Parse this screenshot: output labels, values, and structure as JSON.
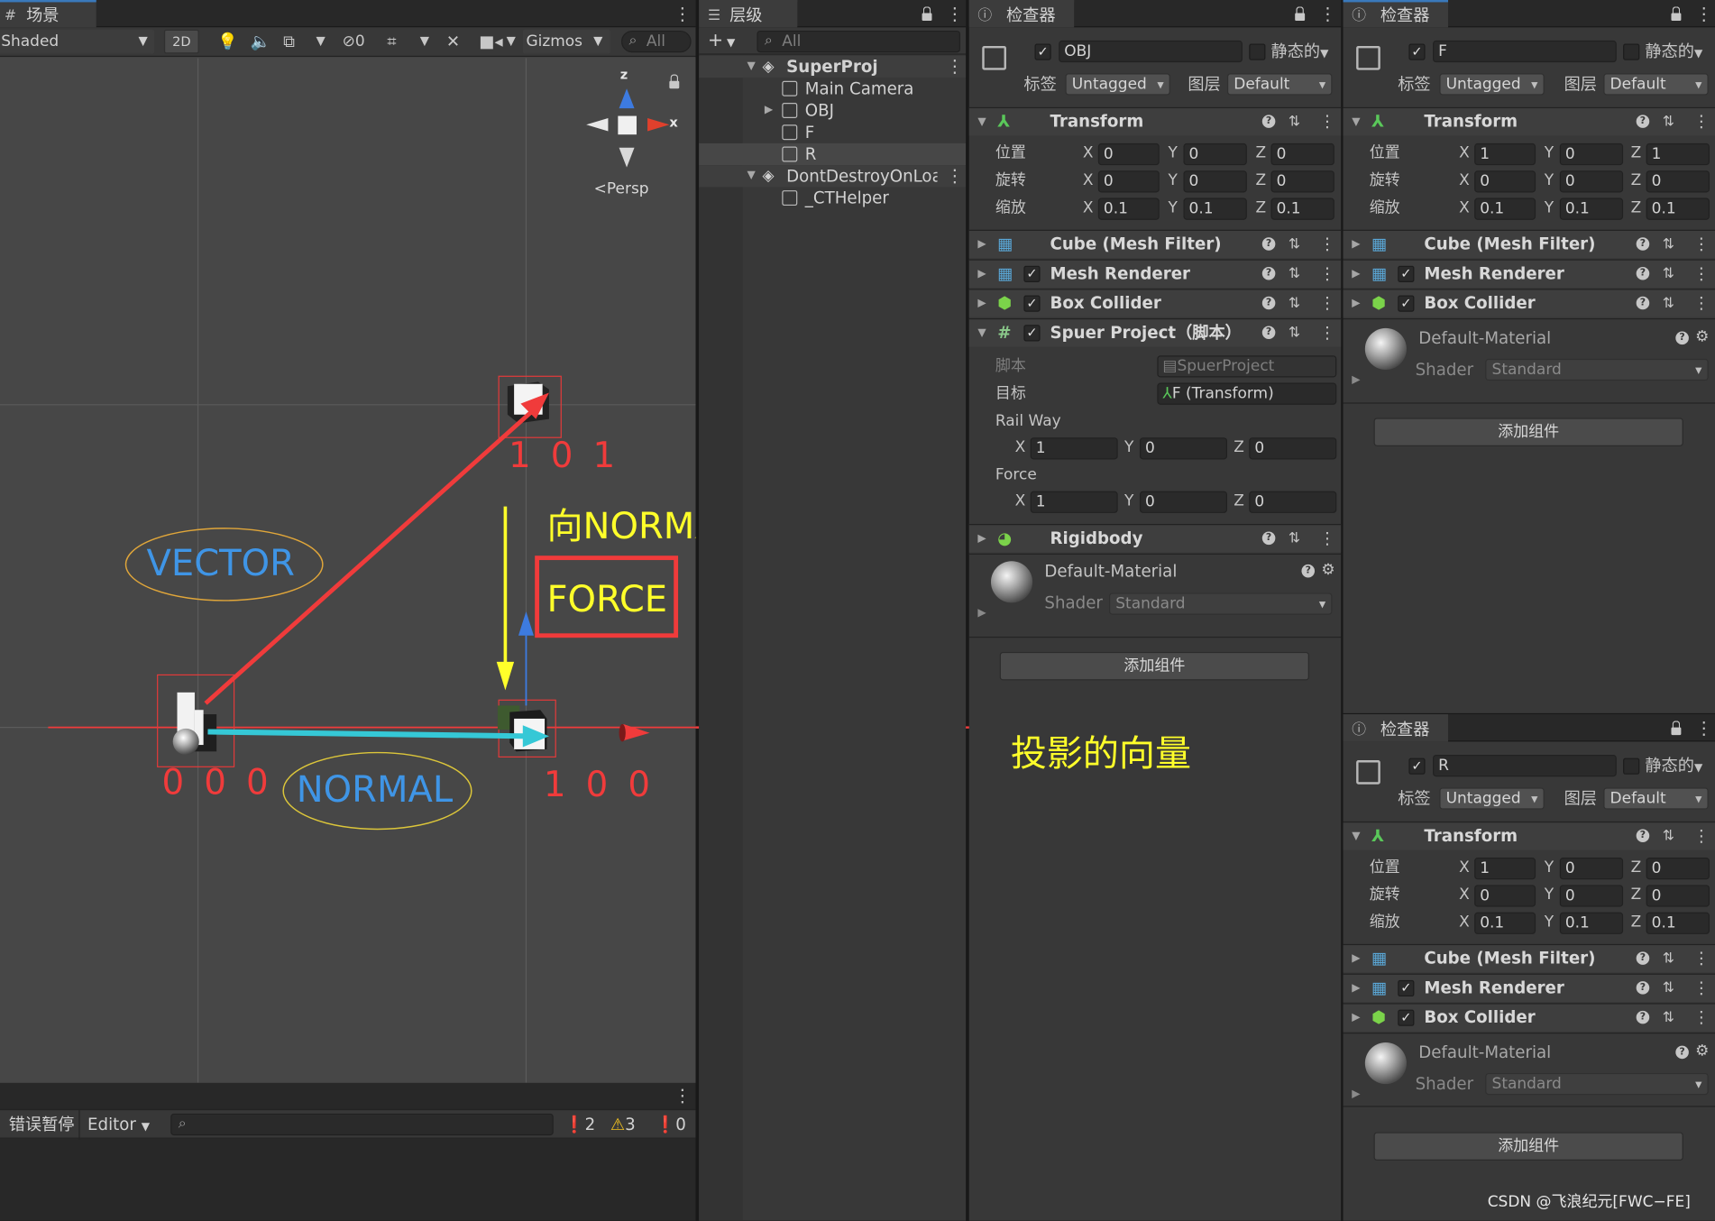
{
  "scene": {
    "tab": "场景",
    "shading": "Shaded",
    "mode_2d": "2D",
    "hidden_count": "0",
    "gizmos": "Gizmos",
    "search_placeholder": "All",
    "persp": "Persp",
    "gizmo_x": "x",
    "gizmo_z": "z"
  },
  "annotations": {
    "p1": "1 0 1",
    "p0": "0 0 0",
    "p2": "1 0 0",
    "vector": "VECTOR",
    "normal": "NORMAL",
    "force": "FORCE",
    "perp": "向NORMAL垂直投影",
    "projected": "投影的向量"
  },
  "console": {
    "error_pause": "错误暂停",
    "editor": "Editor",
    "count_info": "2",
    "count_warn": "3",
    "count_error": "0"
  },
  "hierarchy": {
    "tab": "层级",
    "search_placeholder": "All",
    "items": [
      {
        "label": "SuperProj"
      },
      {
        "label": "Main Camera"
      },
      {
        "label": "OBJ"
      },
      {
        "label": "F"
      },
      {
        "label": "R"
      },
      {
        "label": "DontDestroyOnLoad"
      },
      {
        "label": "_CTHelper"
      }
    ]
  },
  "insp1": {
    "tab": "检查器",
    "name": "OBJ",
    "static": "静态的",
    "tag_label": "标签",
    "tag": "Untagged",
    "layer_label": "图层",
    "layer": "Default",
    "transform": "Transform",
    "pos_label": "位置",
    "rot_label": "旋转",
    "scale_label": "缩放",
    "pos": {
      "x": "0",
      "y": "0",
      "z": "0"
    },
    "rot": {
      "x": "0",
      "y": "0",
      "z": "0"
    },
    "scale": {
      "x": "0.1",
      "y": "0.1",
      "z": "0.1"
    },
    "mesh_filter": "Cube (Mesh Filter)",
    "mesh_renderer": "Mesh Renderer",
    "box_collider": "Box Collider",
    "script_comp": "Spuer Project（脚本）",
    "script_label": "脚本",
    "script_value": "SpuerProject",
    "target_label": "目标",
    "target_value": "F (Transform)",
    "rail_way": "Rail Way",
    "rail": {
      "x": "1",
      "y": "0",
      "z": "0"
    },
    "force_label": "Force",
    "force": {
      "x": "1",
      "y": "0",
      "z": "0"
    },
    "rigidbody": "Rigidbody",
    "material": "Default-Material",
    "shader_label": "Shader",
    "shader": "Standard",
    "add_component": "添加组件"
  },
  "insp2": {
    "tab": "检查器",
    "name": "F",
    "static": "静态的",
    "tag_label": "标签",
    "tag": "Untagged",
    "layer_label": "图层",
    "layer": "Default",
    "transform": "Transform",
    "pos_label": "位置",
    "rot_label": "旋转",
    "scale_label": "缩放",
    "pos": {
      "x": "1",
      "y": "0",
      "z": "1"
    },
    "rot": {
      "x": "0",
      "y": "0",
      "z": "0"
    },
    "scale": {
      "x": "0.1",
      "y": "0.1",
      "z": "0.1"
    },
    "mesh_filter": "Cube (Mesh Filter)",
    "mesh_renderer": "Mesh Renderer",
    "box_collider": "Box Collider",
    "material": "Default-Material",
    "shader_label": "Shader",
    "shader": "Standard",
    "add_component": "添加组件"
  },
  "insp3": {
    "tab": "检查器",
    "name": "R",
    "static": "静态的",
    "tag_label": "标签",
    "tag": "Untagged",
    "layer_label": "图层",
    "layer": "Default",
    "transform": "Transform",
    "pos_label": "位置",
    "rot_label": "旋转",
    "scale_label": "缩放",
    "pos": {
      "x": "1",
      "y": "0",
      "z": "0"
    },
    "rot": {
      "x": "0",
      "y": "0",
      "z": "0"
    },
    "scale": {
      "x": "0.1",
      "y": "0.1",
      "z": "0.1"
    },
    "mesh_filter": "Cube (Mesh Filter)",
    "mesh_renderer": "Mesh Renderer",
    "box_collider": "Box Collider",
    "material": "Default-Material",
    "shader_label": "Shader",
    "shader": "Standard",
    "add_component": "添加组件"
  },
  "watermark": "CSDN @飞浪纪元[FWC−FE]",
  "colors": {
    "annotation_red": "#f03b3b",
    "annotation_yellow": "#ffff2a",
    "annotation_blue": "#3f95e6",
    "cyan": "#35c8d6"
  }
}
